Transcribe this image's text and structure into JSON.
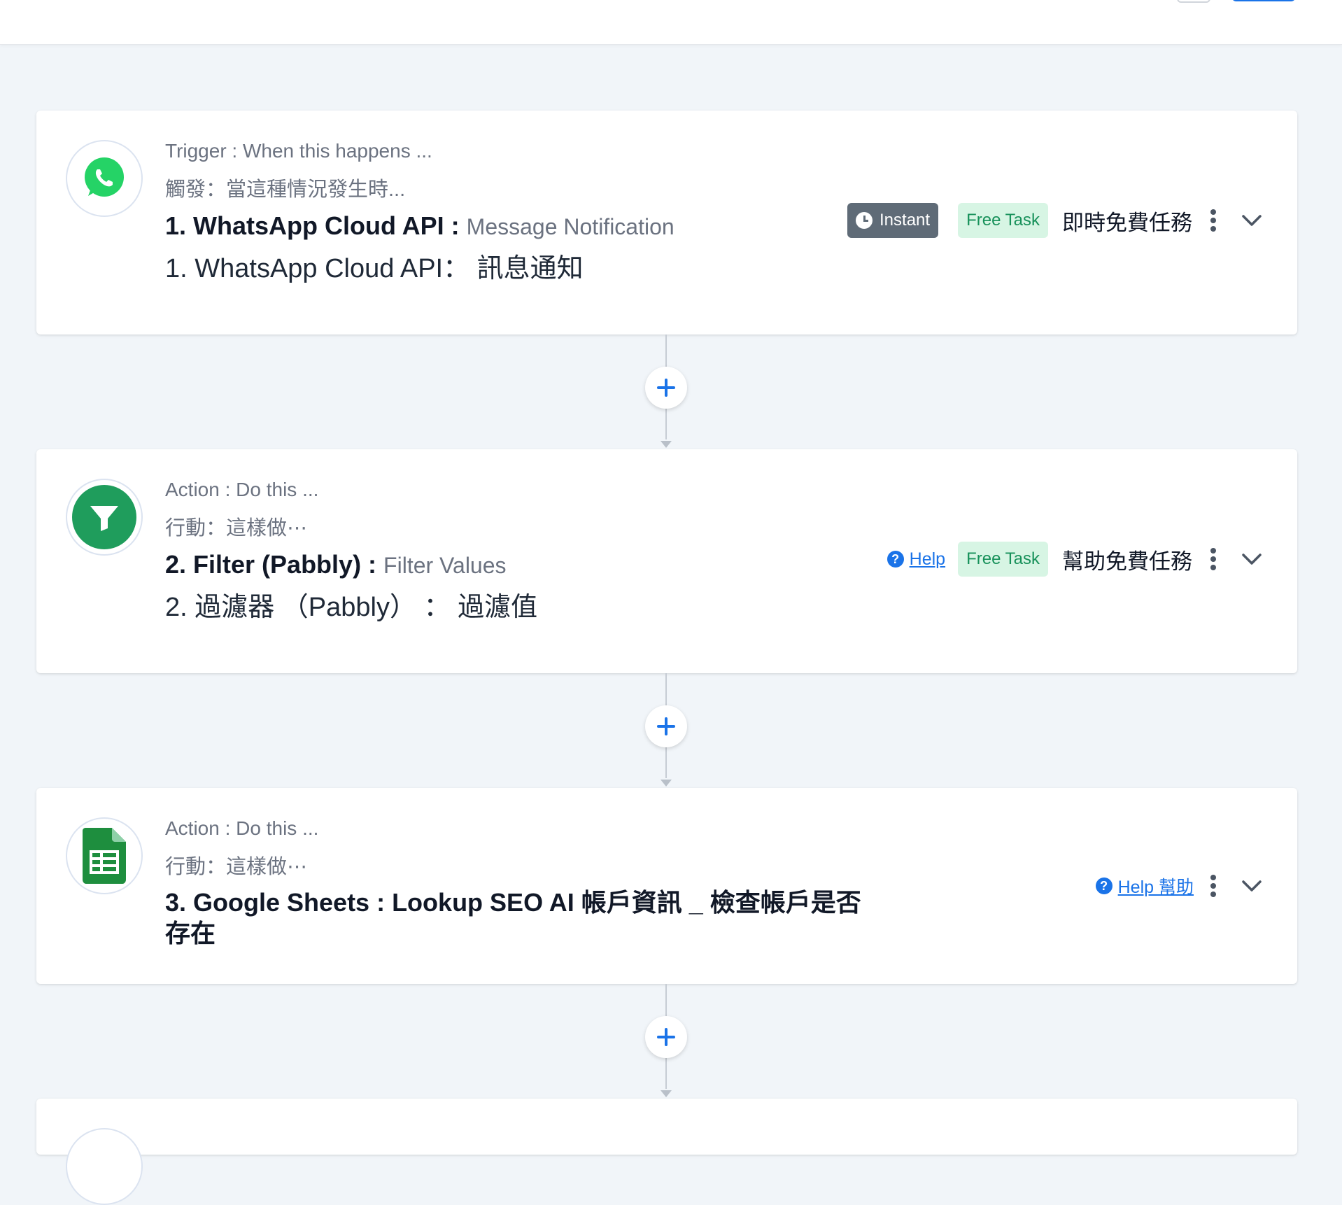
{
  "steps": [
    {
      "label_en": "Trigger : When this happens ...",
      "label_zh": "觸發：當這種情況發生時...",
      "title_main": "1. WhatsApp Cloud API : ",
      "title_sub": "Message Notification",
      "title_zh": "1. WhatsApp Cloud API： 訊息通知",
      "badge_instant": "Instant",
      "badge_free": "Free Task",
      "right_zh": "即時免費任務",
      "icon": "whatsapp-icon"
    },
    {
      "label_en": "Action : Do this ...",
      "label_zh": "行動：這樣做⋯",
      "title_main": "2. Filter (Pabbly) : ",
      "title_sub": "Filter Values",
      "title_zh": "2. 過濾器 （Pabbly） ： 過濾值",
      "help": "Help",
      "badge_free": "Free Task",
      "right_zh": "幫助免費任務",
      "icon": "filter-icon"
    },
    {
      "label_en": "Action : Do this ...",
      "label_zh": "行動：這樣做⋯",
      "title_main": "3. Google Sheets : Lookup SEO AI 帳戶資訊 _ 檢查帳戶是否存在",
      "help": "Help 幫助",
      "icon": "google-sheets-icon"
    }
  ],
  "colors": {
    "accent": "#1a73e8",
    "whatsapp": "#25D366",
    "filter": "#1f9d5c",
    "sheets": "#1e8e3e",
    "free_bg": "#d7f5e4",
    "free_text": "#17915a",
    "instant_bg": "#5f6b77"
  }
}
